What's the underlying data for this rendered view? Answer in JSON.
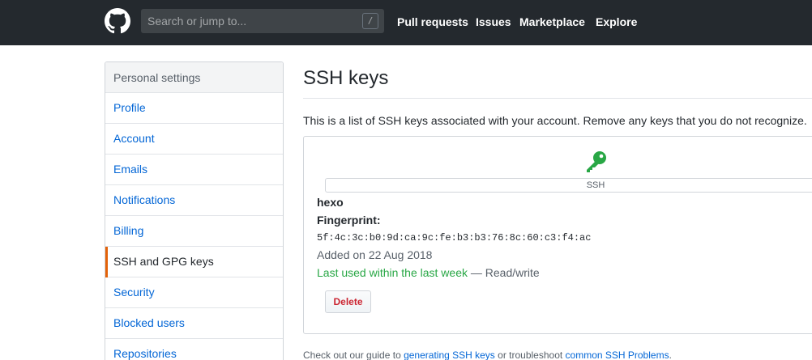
{
  "header": {
    "search_placeholder": "Search or jump to...",
    "search_shortcut": "/",
    "nav": [
      "Pull requests",
      "Issues",
      "Marketplace",
      "Explore"
    ]
  },
  "sidebar": {
    "heading": "Personal settings",
    "items": [
      {
        "label": "Profile"
      },
      {
        "label": "Account"
      },
      {
        "label": "Emails"
      },
      {
        "label": "Notifications"
      },
      {
        "label": "Billing"
      },
      {
        "label": "SSH and GPG keys",
        "selected": true
      },
      {
        "label": "Security"
      },
      {
        "label": "Blocked users"
      },
      {
        "label": "Repositories"
      }
    ]
  },
  "main": {
    "title": "SSH keys",
    "intro": "This is a list of SSH keys associated with your account. Remove any keys that you do not recognize.",
    "key": {
      "type_label": "SSH",
      "title": "hexo",
      "fingerprint_label": "Fingerprint:",
      "fingerprint": "5f:4c:3c:b0:9d:ca:9c:fe:b3:b3:76:8c:60:c3:f4:ac",
      "added": "Added on 22 Aug 2018",
      "last_used": "Last used within the last week",
      "access": "— Read/write",
      "delete_label": "Delete",
      "icon": "key-icon"
    },
    "footer": {
      "prefix": "Check out our guide to ",
      "link1": "generating SSH keys",
      "middle": " or troubleshoot ",
      "link2": "common SSH Problems",
      "suffix": "."
    }
  },
  "colors": {
    "header_bg": "#24292e",
    "link": "#0366d6",
    "selected_accent": "#e36209",
    "key_green": "#28a745",
    "danger": "#cb2431"
  }
}
